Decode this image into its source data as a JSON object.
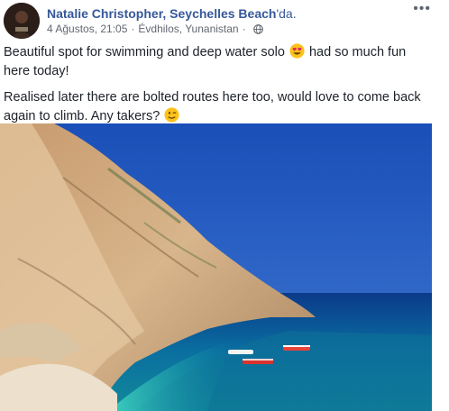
{
  "post": {
    "author": "Natalie Christopher",
    "separator": ",",
    "location": "Seychelles Beach",
    "location_suffix": "'da.",
    "date": "4 Ağustos, 21:05",
    "dot": "·",
    "place": "Évdhilos, Yunanistan",
    "dot2": "·",
    "privacy_icon": "globe-icon",
    "more_label": "•••",
    "text_line1_part1": "Beautiful spot for swimming and deep water solo",
    "emoji1": "heart-eyes-emoji",
    "text_line1_part2": "had so much fun here today!",
    "text_line2": "Realised later there are bolted routes here too, would love to come back again to climb. Any takers?",
    "emoji2": "winking-emoji",
    "photo_subject": "cliffs-and-turquoise-sea-photo"
  },
  "colors": {
    "link": "#365899",
    "meta": "#616770",
    "text": "#1d2129"
  }
}
